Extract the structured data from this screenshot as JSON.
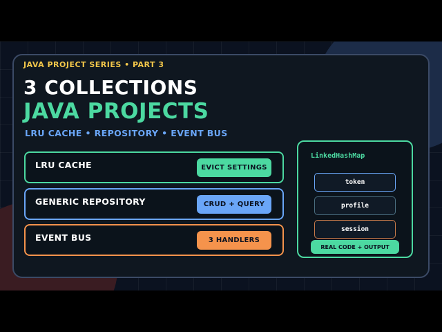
{
  "header": {
    "kicker": "JAVA PROJECT SERIES • PART 3",
    "title_line1": "3 COLLECTIONS",
    "title_line2": "JAVA PROJECTS",
    "subtitle": "LRU CACHE • REPOSITORY • EVENT BUS"
  },
  "projects": [
    {
      "label": "LRU CACHE",
      "tag": "EVICT SETTINGS",
      "color": "#4cd9a1"
    },
    {
      "label": "GENERIC REPOSITORY",
      "tag": "CRUD + QUERY",
      "color": "#6aa6f8"
    },
    {
      "label": "EVENT BUS",
      "tag": "3 HANDLERS",
      "color": "#f5934c"
    }
  ],
  "panel": {
    "title": "LinkedHashMap",
    "entries": [
      "token",
      "profile",
      "session"
    ],
    "badge": "REAL CODE + OUTPUT"
  },
  "colors": {
    "accent_green": "#4cd9a1",
    "accent_blue": "#6aa6f8",
    "accent_orange": "#f5934c",
    "accent_yellow": "#f3c74a",
    "background": "#0b1220"
  }
}
